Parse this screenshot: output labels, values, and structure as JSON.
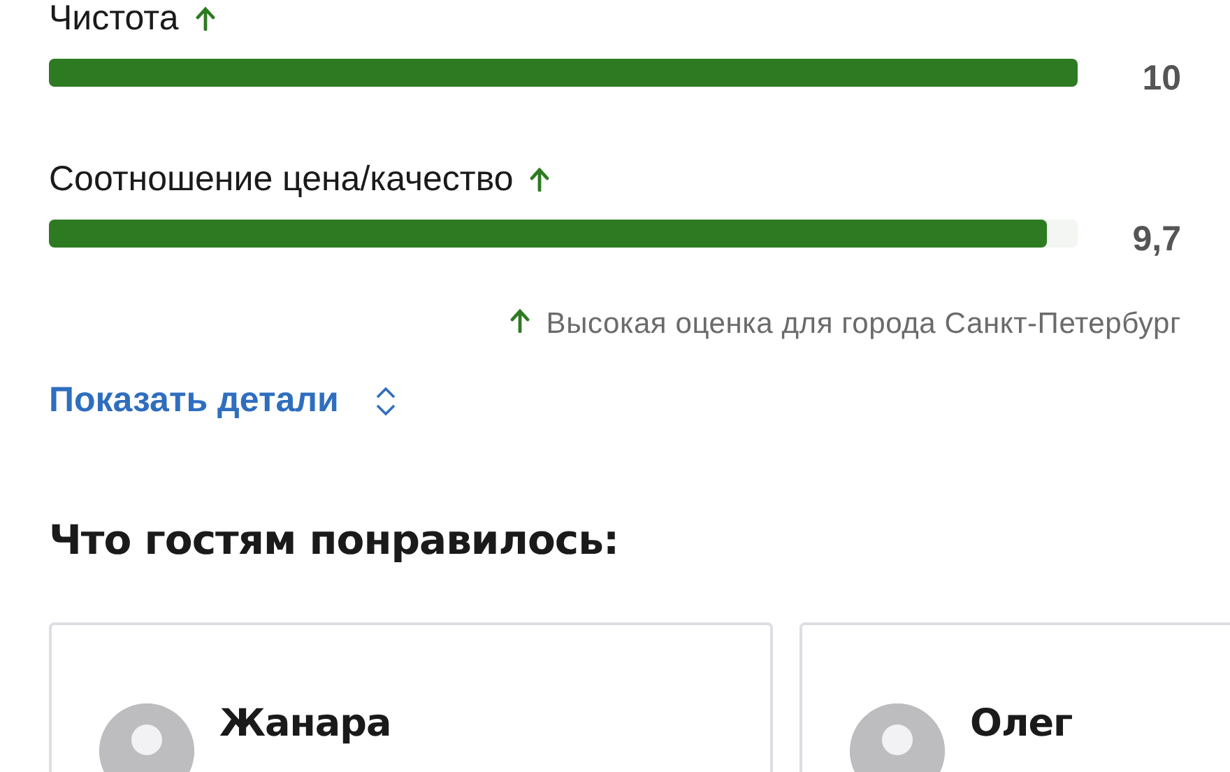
{
  "ratings": [
    {
      "label": "Чистота",
      "trend_up": true,
      "level": 1.0,
      "score": "10"
    },
    {
      "label": "Соотношение цена/качество",
      "trend_up": true,
      "level": 0.97,
      "score": "9,7"
    }
  ],
  "city_note": {
    "trend_up": true,
    "text": "Высокая оценка для города Санкт-Петербург"
  },
  "details_link": "Показать детали",
  "liked_heading": "Что гостям понравилось:",
  "reviews": [
    {
      "name": "Жанара"
    },
    {
      "name": "Олег"
    }
  ]
}
